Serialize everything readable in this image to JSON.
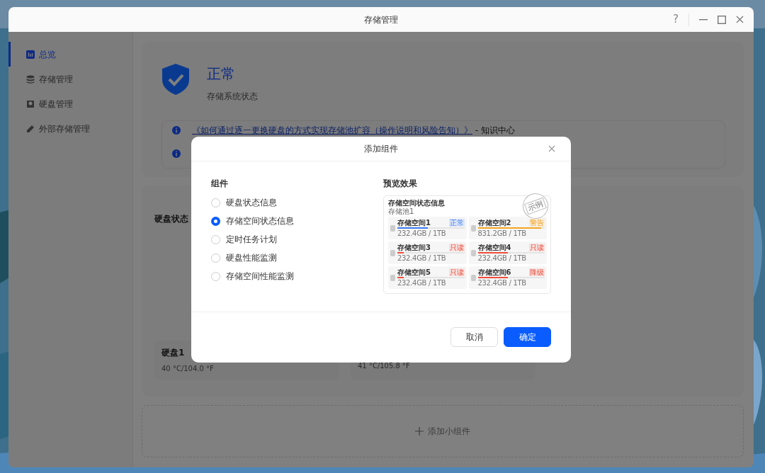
{
  "window": {
    "title": "存储管理",
    "help": "?"
  },
  "sidebar": {
    "items": [
      {
        "label": "总览",
        "selected": true
      },
      {
        "label": "存储管理",
        "selected": false
      },
      {
        "label": "硬盘管理",
        "selected": false
      },
      {
        "label": "外部存储管理",
        "selected": false
      }
    ]
  },
  "status": {
    "title": "正常",
    "subtitle": "存储系统状态"
  },
  "notices": [
    {
      "link": "《如何通过逐一更换硬盘的方式实现存储池扩容（操作说明和风险告知）》",
      "suffix": " - 知识中心"
    }
  ],
  "disk_widget": {
    "title": "硬盘状态",
    "disks": [
      {
        "name": "硬盘1",
        "temperature": "40 °C/104.0 °F"
      },
      {
        "temperature": "41 °C/105.8 °F"
      }
    ]
  },
  "add_widget": {
    "label": "添加小组件"
  },
  "dialog": {
    "title": "添加组件",
    "section_title": "组件",
    "options": [
      {
        "label": "硬盘状态信息",
        "selected": false
      },
      {
        "label": "存储空间状态信息",
        "selected": true
      },
      {
        "label": "定时任务计划",
        "selected": false
      },
      {
        "label": "硬盘性能监测",
        "selected": false
      },
      {
        "label": "存储空间性能监测",
        "selected": false
      }
    ],
    "preview_title": "预览效果",
    "preview": {
      "title": "存储空间状态信息",
      "pool": "存储池1",
      "stamp": "示例",
      "spaces": [
        {
          "name": "存储空间1",
          "badge": "正常",
          "color": "#3b7bf6",
          "level": 0.45,
          "usage": "232.4GB / 1TB"
        },
        {
          "name": "存储空间2",
          "badge": "警告",
          "color": "#f5a623",
          "level": 0.95,
          "usage": "831.2GB / 1TB"
        },
        {
          "name": "存储空间3",
          "badge": "只读",
          "color": "#f04d3a",
          "level": 0.1,
          "usage": "232.4GB / 1TB"
        },
        {
          "name": "存储空间4",
          "badge": "只读",
          "color": "#f04d3a",
          "level": 0.45,
          "usage": "232.4GB / 1TB"
        },
        {
          "name": "存储空间5",
          "badge": "只读",
          "color": "#f04d3a",
          "level": 0.1,
          "usage": "232.4GB / 1TB"
        },
        {
          "name": "存储空间6",
          "badge": "降级",
          "color": "#f04d3a",
          "level": 0.45,
          "usage": "232.4GB / 1TB"
        }
      ]
    },
    "buttons": [
      {
        "label": "取消",
        "kind": "secondary"
      },
      {
        "label": "确定",
        "kind": "primary"
      }
    ]
  }
}
